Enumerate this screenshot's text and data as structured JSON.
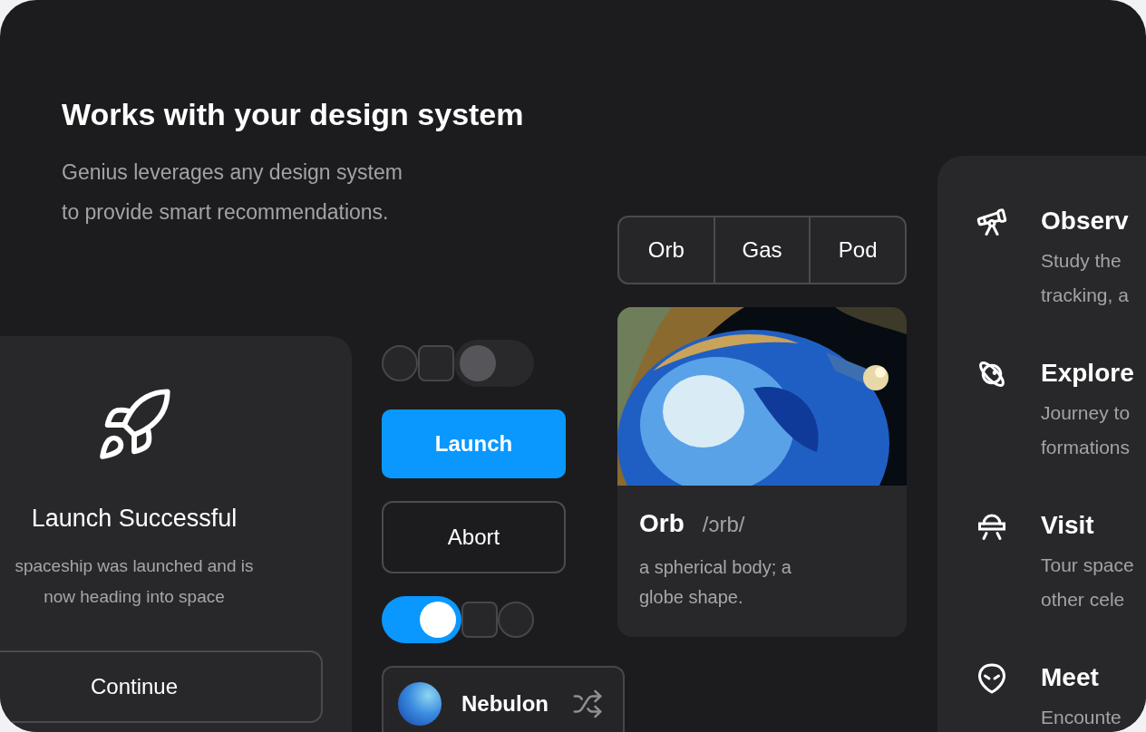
{
  "header": {
    "title": "Works with your design system",
    "subtitle": "Genius leverages any design system to provide smart recommendations."
  },
  "launch_card": {
    "title": "Launch Successful",
    "message": "spaceship was launched and is now heading into space",
    "button": "Continue"
  },
  "controls_top": [
    {
      "kind": "radio",
      "checked": false
    },
    {
      "kind": "checkbox",
      "checked": false
    },
    {
      "kind": "switch",
      "checked": false
    }
  ],
  "primary_button": "Launch",
  "secondary_button": "Abort",
  "controls_bottom": [
    {
      "kind": "switch",
      "checked": true
    },
    {
      "kind": "checkbox",
      "checked": false
    },
    {
      "kind": "radio",
      "checked": false
    }
  ],
  "chip": {
    "label": "Nebulon"
  },
  "segments": [
    {
      "label": "Orb"
    },
    {
      "label": "Gas"
    },
    {
      "label": "Pod"
    }
  ],
  "word_card": {
    "word": "Orb",
    "pronunciation": "/ɔrb/",
    "definition": "a spherical body; a globe shape."
  },
  "features": [
    {
      "kind": "telescope",
      "title": "Observ",
      "description": "Study the tracking, a"
    },
    {
      "kind": "planet",
      "title": "Explore",
      "description": "Journey to formations"
    },
    {
      "kind": "ufo",
      "title": "Visit",
      "description": "Tour space other cele"
    },
    {
      "kind": "alien",
      "title": "Meet",
      "description": "Encounte"
    }
  ]
}
